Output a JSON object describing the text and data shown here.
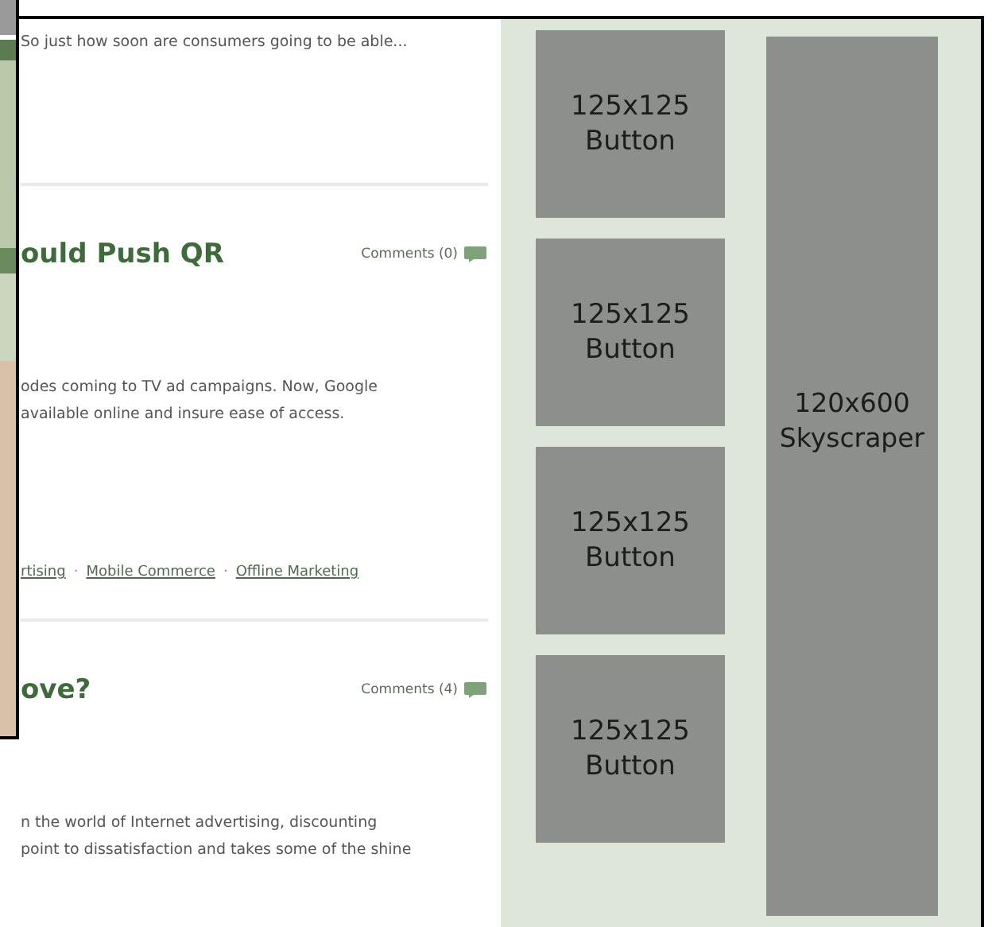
{
  "posts": [
    {
      "body": [
        "So just how soon are consumers going to be able..."
      ]
    },
    {
      "title": "ould Push QR",
      "comments": "Comments (0)",
      "body": [
        "odes coming to TV ad campaigns. Now, Google",
        "available online and insure ease of access."
      ],
      "tags": [
        "rtising",
        "Mobile Commerce",
        "Offline Marketing"
      ],
      "tag_separator": "·"
    },
    {
      "title": "ove?",
      "comments": "Comments (4)",
      "body": [
        "n the world of Internet advertising, discounting",
        "point to dissatisfaction and takes some of the shine"
      ]
    }
  ],
  "sidebar": {
    "buttons": [
      "125x125 Button",
      "125x125 Button",
      "125x125 Button",
      "125x125 Button"
    ],
    "skyscraper": "120x600 Skyscraper"
  }
}
